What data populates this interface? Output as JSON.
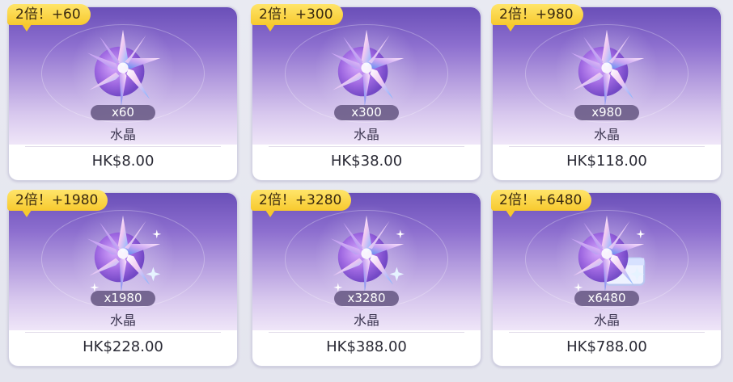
{
  "colors": {
    "badge": "#f7c92e",
    "qty_pill": "#5f507d",
    "art_top": "#6a4fb8",
    "art_bottom": "#efe6f8"
  },
  "items": [
    {
      "badge": "2倍！+60",
      "qty": "x60",
      "name": "水晶",
      "price": "HK$8.00",
      "icon": "crystal-icon"
    },
    {
      "badge": "2倍！+300",
      "qty": "x300",
      "name": "水晶",
      "price": "HK$38.00",
      "icon": "crystal-icon"
    },
    {
      "badge": "2倍！+980",
      "qty": "x980",
      "name": "水晶",
      "price": "HK$118.00",
      "icon": "crystal-icon"
    },
    {
      "badge": "2倍！+1980",
      "qty": "x1980",
      "name": "水晶",
      "price": "HK$228.00",
      "icon": "crystal-cluster-icon"
    },
    {
      "badge": "2倍！+3280",
      "qty": "x3280",
      "name": "水晶",
      "price": "HK$388.00",
      "icon": "crystal-cluster-icon"
    },
    {
      "badge": "2倍！+6480",
      "qty": "x6480",
      "name": "水晶",
      "price": "HK$788.00",
      "icon": "crystal-chest-icon"
    }
  ]
}
